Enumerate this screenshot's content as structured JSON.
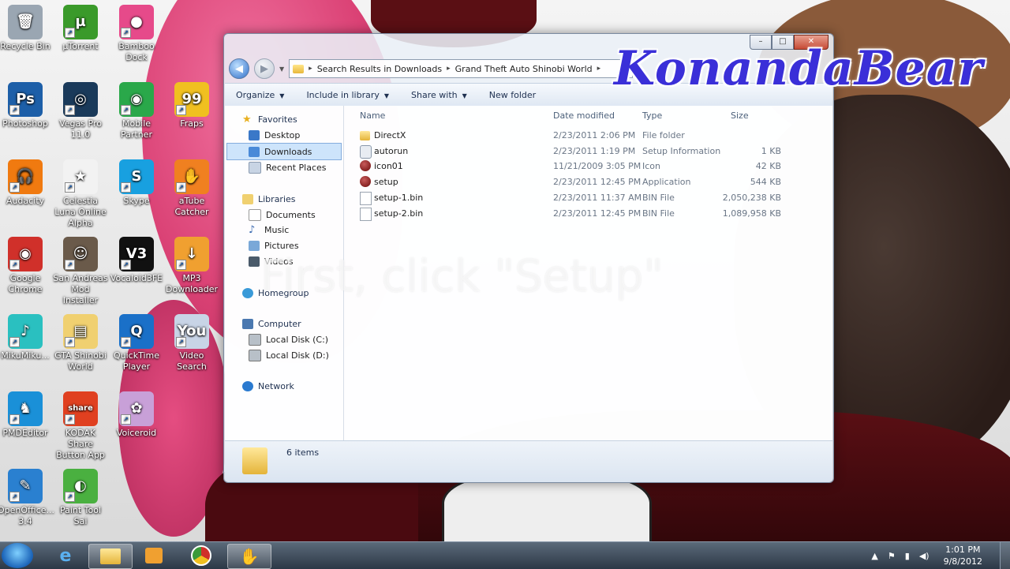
{
  "watermark": "KonandaBear",
  "overlay_caption": "First, click \"Setup\"",
  "desktop_icons": [
    {
      "label": "Recycle Bin",
      "color": "#9aa6b2",
      "glyph": "🗑"
    },
    {
      "label": "µTorrent",
      "color": "#3a9a2a",
      "glyph": "µ"
    },
    {
      "label": "Bamboo Dock",
      "color": "#e64a8a",
      "glyph": "●"
    },
    {
      "label": "Photoshop",
      "color": "#1d5fa8",
      "glyph": "Ps"
    },
    {
      "label": "Vegas Pro 11.0",
      "color": "#1a3a5a",
      "glyph": "◎"
    },
    {
      "label": "Mobile Partner",
      "color": "#2aa84a",
      "glyph": "◉"
    },
    {
      "label": "Fraps",
      "color": "#f0c020",
      "glyph": "99"
    },
    {
      "label": "Audacity",
      "color": "#f07a10",
      "glyph": "🎧"
    },
    {
      "label": "Celestia Luna Online Alpha",
      "color": "#f2f2f2",
      "glyph": "★"
    },
    {
      "label": "Skype",
      "color": "#18a0e0",
      "glyph": "S"
    },
    {
      "label": "aTube Catcher",
      "color": "#f08020",
      "glyph": "✋"
    },
    {
      "label": "Google Chrome",
      "color": "#d0302a",
      "glyph": "◉"
    },
    {
      "label": "San Andreas Mod Installer",
      "color": "#6a5a4a",
      "glyph": "☺"
    },
    {
      "label": "Vocaloid3FE",
      "color": "#111111",
      "glyph": "V3"
    },
    {
      "label": "MP3 Downloader",
      "color": "#f0a030",
      "glyph": "↓"
    },
    {
      "label": "MikuMiku...",
      "color": "#2ac0c0",
      "glyph": "♪"
    },
    {
      "label": "GTA Shinobi World",
      "color": "#f0d070",
      "glyph": "▤"
    },
    {
      "label": "QuickTime Player",
      "color": "#1a70c8",
      "glyph": "Q"
    },
    {
      "label": "Video Search",
      "color": "#c8d4e6",
      "glyph": "You"
    },
    {
      "label": "PMDEditor",
      "color": "#1a90d8",
      "glyph": "♞"
    },
    {
      "label": "KODAK Share Button App",
      "color": "#e04020",
      "glyph": "share"
    },
    {
      "label": "Voiceroid",
      "color": "#c8a0d8",
      "glyph": "✿"
    },
    {
      "label": "OpenOffice... 3.4",
      "color": "#2a80d0",
      "glyph": "✎"
    },
    {
      "label": "Paint Tool Sai",
      "color": "#4ab040",
      "glyph": "◐"
    }
  ],
  "window": {
    "caption": {
      "min": "–",
      "max": "□",
      "close": "✕"
    },
    "breadcrumb": [
      "Search Results in Downloads",
      "Grand Theft Auto Shinobi World"
    ],
    "toolbar": {
      "organize": "Organize",
      "include": "Include in library",
      "share": "Share with",
      "newfolder": "New folder"
    },
    "nav": {
      "favorites": "Favorites",
      "desktop": "Desktop",
      "downloads": "Downloads",
      "recent": "Recent Places",
      "libraries": "Libraries",
      "documents": "Documents",
      "music": "Music",
      "pictures": "Pictures",
      "videos": "Videos",
      "homegroup": "Homegroup",
      "computer": "Computer",
      "disk_c": "Local Disk (C:)",
      "disk_d": "Local Disk (D:)",
      "network": "Network"
    },
    "columns": {
      "name": "Name",
      "date": "Date modified",
      "type": "Type",
      "size": "Size"
    },
    "files": [
      {
        "name": "DirectX",
        "date": "2/23/2011 2:06 PM",
        "type": "File folder",
        "size": "",
        "icon": "folder"
      },
      {
        "name": "autorun",
        "date": "2/23/2011 1:19 PM",
        "type": "Setup Information",
        "size": "1 KB",
        "icon": "settings"
      },
      {
        "name": "icon01",
        "date": "11/21/2009 3:05 PM",
        "type": "Icon",
        "size": "42 KB",
        "icon": "red-ball"
      },
      {
        "name": "setup",
        "date": "2/23/2011 12:45 PM",
        "type": "Application",
        "size": "544 KB",
        "icon": "red-ball"
      },
      {
        "name": "setup-1.bin",
        "date": "2/23/2011 11:37 AM",
        "type": "BIN File",
        "size": "2,050,238 KB",
        "icon": "file"
      },
      {
        "name": "setup-2.bin",
        "date": "2/23/2011 12:45 PM",
        "type": "BIN File",
        "size": "1,089,958 KB",
        "icon": "file"
      }
    ],
    "status": "6 items"
  },
  "taskbar": {
    "time": "1:01 PM",
    "date": "9/8/2012"
  }
}
